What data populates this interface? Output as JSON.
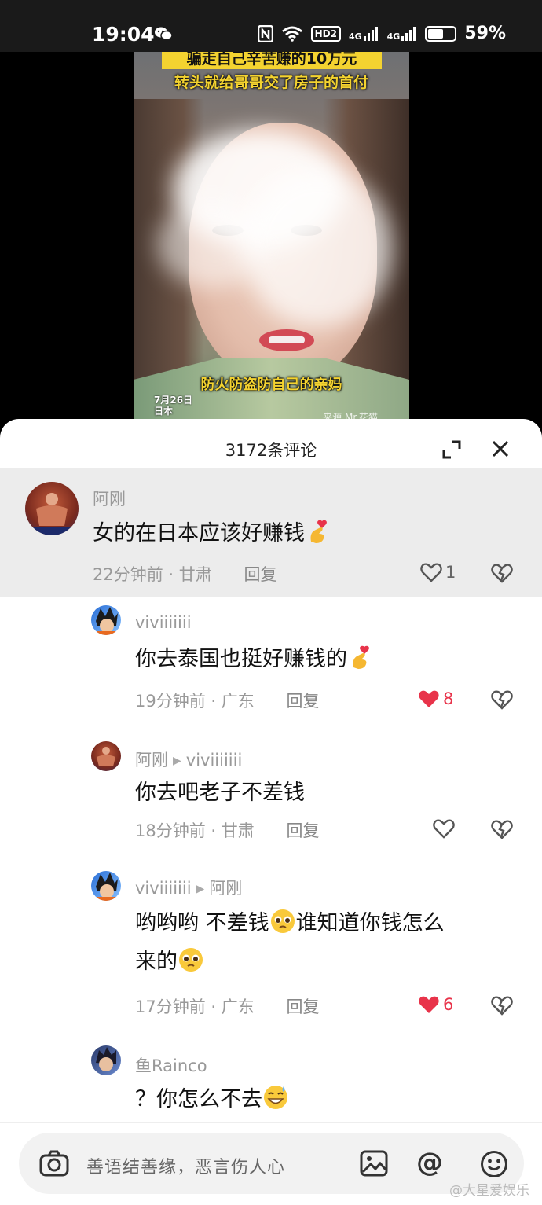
{
  "status_bar": {
    "time": "19:04",
    "battery": "59%",
    "battery_level": 0.59,
    "hd": "HD2",
    "sig1": "4G",
    "sig2": "4G"
  },
  "video": {
    "caption_top": "骗走自己辛苦赚的10万元",
    "caption_sub": "转头就给哥哥交了房子的首付",
    "caption_bottom": "防火防盗防自己的亲妈",
    "date_line1": "7月26日",
    "date_line2": "日本",
    "source": "来源 Mr.花猫"
  },
  "sheet": {
    "title": "3172条评论"
  },
  "comments": [
    {
      "name": "阿刚",
      "reply_to": "",
      "text": "女的在日本应该好赚钱",
      "emoji": "finger-heart",
      "time": "22分钟前",
      "location": "甘肃",
      "reply_label": "回复",
      "likes": "1",
      "liked": false
    },
    {
      "name": "viviiiiiii",
      "reply_to": "",
      "text": "你去泰国也挺好赚钱的",
      "emoji": "finger-heart",
      "time": "19分钟前",
      "location": "广东",
      "reply_label": "回复",
      "likes": "8",
      "liked": true
    },
    {
      "name": "阿刚",
      "reply_to": "viviiiiiii",
      "text": "你去吧老子不差钱",
      "emoji": "",
      "time": "18分钟前",
      "location": "甘肃",
      "reply_label": "回复",
      "likes": "",
      "liked": false
    },
    {
      "name": "viviiiiiii",
      "reply_to": "阿刚",
      "text_line1_a": "哟哟哟 不差钱",
      "text_line1_b": "谁知道你钱怎么",
      "text_line2": "来的",
      "time": "17分钟前",
      "location": "广东",
      "reply_label": "回复",
      "likes": "6",
      "liked": true
    },
    {
      "name": "鱼Rainco",
      "reply_to": "",
      "text": "？你怎么不去",
      "emoji": "sweat-smile"
    }
  ],
  "input_bar": {
    "placeholder": "善语结善缘，恶言伤人心"
  },
  "watermark": "@大星爱娱乐",
  "colors": {
    "like_red": "#e8334a",
    "caption_yellow": "#f4d330"
  }
}
